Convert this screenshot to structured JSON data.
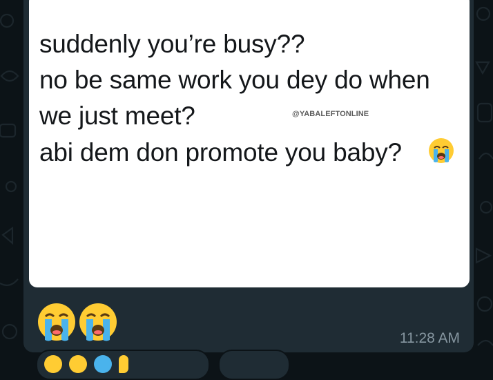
{
  "tweet": {
    "lines": [
      "suddenly you’re busy??",
      "no be same work you dey do when",
      "we just meet?",
      "abi dem don promote you baby?"
    ],
    "watermark": "@YABALEFTONLINE",
    "inline_emoji": "crying-face-emoji"
  },
  "message": {
    "caption_emojis": [
      "crying-face-emoji",
      "crying-face-emoji"
    ],
    "time": "11:28 AM"
  },
  "colors": {
    "chat_background": "#0c1317",
    "bubble": "#1f2c34",
    "timestamp": "#8696a0",
    "tweet_text": "#14171a"
  }
}
